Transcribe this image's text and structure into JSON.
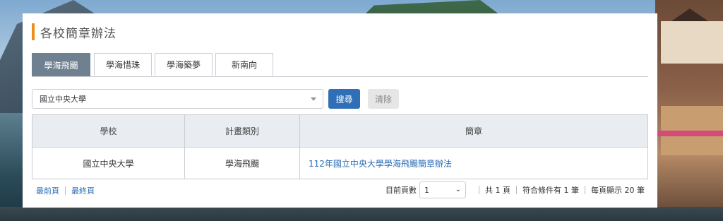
{
  "page": {
    "title": "各校簡章辦法"
  },
  "tabs": [
    {
      "label": "學海飛颺",
      "active": true
    },
    {
      "label": "學海惜珠",
      "active": false
    },
    {
      "label": "學海築夢",
      "active": false
    },
    {
      "label": "新南向",
      "active": false
    }
  ],
  "filter": {
    "school_value": "國立中央大學",
    "search_label": "搜尋",
    "clear_label": "清除"
  },
  "table": {
    "columns": [
      "學校",
      "計畫類別",
      "簡章"
    ],
    "rows": [
      {
        "school": "國立中央大學",
        "category": "學海飛颺",
        "brochure": "112年國立中央大學學海飛颺簡章辦法"
      }
    ]
  },
  "pager": {
    "first_label": "最前頁",
    "last_label": "最終頁",
    "current_page_label": "目前頁數",
    "current_page": "1",
    "total_pages_text": "共 1 頁",
    "matching_text": "符合條件有 1 筆",
    "per_page_text": "每頁顯示 20 筆"
  },
  "colors": {
    "accent": "#f08c1e",
    "active_tab": "#6f8191",
    "primary": "#2f6fb5",
    "link": "#2a6db5"
  }
}
